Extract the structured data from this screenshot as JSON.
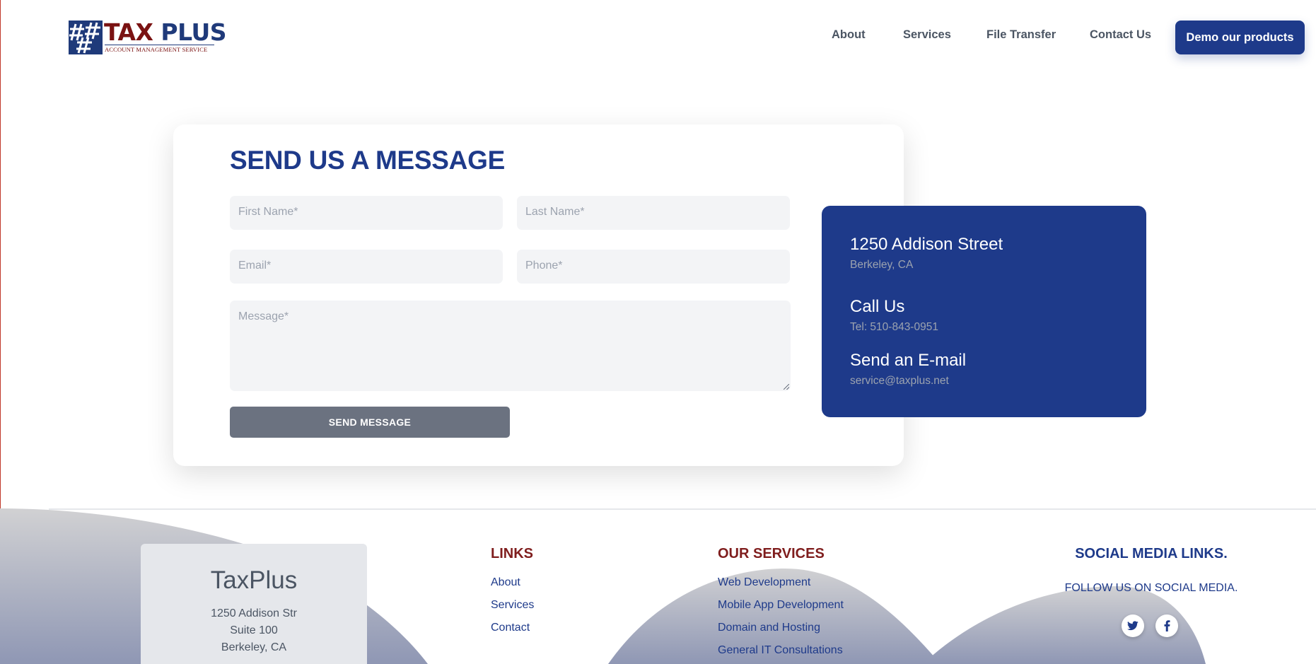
{
  "header": {
    "logo": {
      "title_part1": "TAX",
      "title_part2": " PLUS",
      "subtitle": "ACCOUNT MANAGEMENT SERVICE"
    },
    "nav": [
      "About",
      "Services",
      "File Transfer",
      "Contact Us"
    ],
    "demo_button": "Demo our products"
  },
  "form": {
    "title": "SEND US A MESSAGE",
    "first_name_placeholder": "First Name*",
    "last_name_placeholder": "Last Name*",
    "email_placeholder": "Email*",
    "phone_placeholder": "Phone*",
    "message_placeholder": "Message*",
    "submit_label": "SEND MESSAGE"
  },
  "contact_info": {
    "address_heading": "1250 Addison Street",
    "address_city": "Berkeley, CA",
    "call_heading": "Call Us",
    "phone": "Tel: 510-843-0951",
    "email_heading": "Send an E-mail",
    "email": "service@taxplus.net"
  },
  "footer": {
    "company": {
      "name": "TaxPlus",
      "address_lines": [
        "1250 Addison Str",
        "Suite 100",
        "Berkeley, CA"
      ]
    },
    "links": {
      "heading": "LINKS",
      "items": [
        "About",
        "Services",
        "Contact"
      ]
    },
    "services": {
      "heading": "OUR SERVICES",
      "items": [
        "Web Development",
        "Mobile App Development",
        "Domain and Hosting",
        "General IT Consultations"
      ]
    },
    "social": {
      "heading": "SOCIAL MEDIA LINKS.",
      "subheading": "FOLLOW US ON SOCIAL MEDIA.",
      "icons": [
        "twitter-icon",
        "facebook-icon"
      ]
    }
  },
  "colors": {
    "brand_blue": "#1e3a8a",
    "brand_red": "#7f1d1d",
    "button_gray": "#6b7280",
    "field_bg": "#f3f4f6"
  }
}
